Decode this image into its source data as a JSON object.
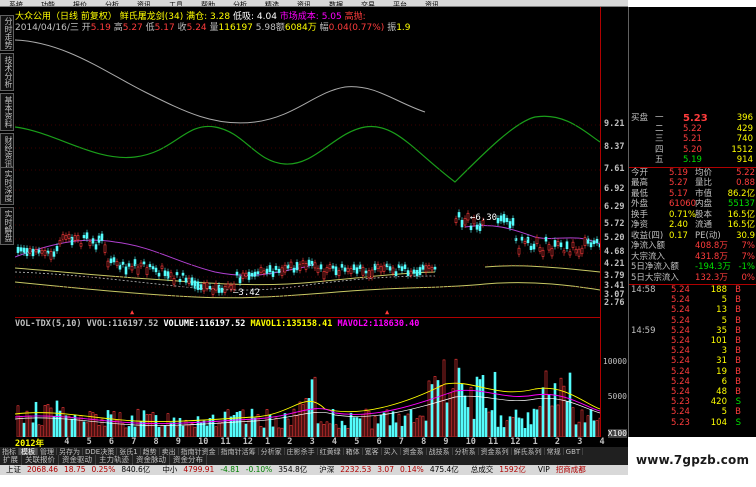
{
  "colors": {
    "background": "#000000",
    "up": "#ff3c3c",
    "down": "#54fcfc",
    "yellow": "#ffff00",
    "magenta": "#ff00ff",
    "white": "#ffffff",
    "axis": "#b00000",
    "green_line": "#1a9e1a",
    "gray_line": "#aaaaaa",
    "purple_line": "#b040d0"
  },
  "menu_strip": [
    "系统",
    "功能",
    "报价",
    "分析",
    "资讯",
    "工具",
    "帮助",
    "分析",
    "精选",
    "资讯",
    "数据",
    "交易",
    "平台",
    "资讯"
  ],
  "left_tabs": [
    "分时走势",
    "技术分析",
    "基本资料",
    "财经资讯",
    "实时深度",
    "实时解盘"
  ],
  "title": {
    "stock": "大众公用（日线 前复权）",
    "formula": "鲜氏屠龙剑(34)",
    "pos_label": "满仓:",
    "pos_value": "3.28",
    "low_label": "低吸:",
    "low_value": "4.04",
    "cost_label": "市场成本:",
    "cost_value": "5.05",
    "hi_label": "高抛:"
  },
  "info": {
    "date": "2014/04/16/三",
    "open_label": "开",
    "open": "5.19",
    "high_label": "高",
    "high": "5.27",
    "low_label": "低",
    "low": "5.17",
    "close_label": "收",
    "close": "5.24",
    "vol_label": "量",
    "vol": "116197",
    "amt": "5.98",
    "amt_label": "6084万",
    "amt_word": "额",
    "chg_label": "幅",
    "chg": "0.04",
    "chg_pct": "(0.77%)",
    "turn_label": "振",
    "turn": "1.9"
  },
  "price_ticks": [
    "9.21",
    "8.37",
    "7.61",
    "6.92",
    "6.29",
    "5.72",
    "5.20",
    "4.68",
    "4.21",
    "3.79",
    "3.41",
    "3.07",
    "2.76"
  ],
  "chart_annotations": {
    "high_mark": "6.30",
    "low_mark": "3.42"
  },
  "volume": {
    "title": "VOL-TDX(5,10)",
    "vvol_label": "VVOL:",
    "vvol": "116197.52",
    "volume_label": "VOLUME:",
    "volume": "116197.52",
    "mavol1_label": "MAVOL1:",
    "mavol1": "135158.41",
    "mavol2_label": "MAVOL2:",
    "mavol2": "118630.40",
    "ticks": [
      "10000",
      "5000"
    ],
    "unit": "X100"
  },
  "date_axis": [
    "2012年",
    "4",
    "5",
    "6",
    "7",
    "8",
    "9",
    "10",
    "11",
    "12",
    "1",
    "2",
    "3",
    "4",
    "5",
    "6",
    "7",
    "8",
    "9",
    "10",
    "11",
    "12",
    "1",
    "2",
    "3",
    "4"
  ],
  "bottom_tabs": [
    "指标",
    "模板",
    "管理",
    "另存为",
    "DDE决策",
    "张氏1",
    "趋势",
    "卖出",
    "指南针资金",
    "指南针活筹",
    "分析家",
    "庄影杀手",
    "红黄绿",
    "箱体",
    "宽客",
    "买入",
    "资金系",
    "战技系",
    "分析系",
    "资金系列",
    "鲜氏系列",
    "常规",
    "GBT"
  ],
  "sub_tabs": [
    "扩展",
    "关联报价",
    "资金驱动",
    "主力轨迹",
    "资金脉动",
    "资金分布"
  ],
  "status_bar": [
    {
      "label": "上证",
      "value": "2068.46",
      "chg": "18.75",
      "pct": "0.25%",
      "amt": "840.6亿"
    },
    {
      "label": "中小",
      "value": "4799.91",
      "chg": "-4.81",
      "pct": "-0.10%",
      "amt": "354.8亿"
    },
    {
      "label": "沪深",
      "value": "2232.53",
      "chg": "3.07",
      "pct": "0.14%",
      "amt": "475.4亿"
    },
    {
      "label": "总成交",
      "value": "1592亿"
    },
    {
      "label": "VIP",
      "value": "招商成都"
    }
  ],
  "right_panel": {
    "bids": [
      {
        "label": "一",
        "price": "5.23",
        "vol": "396"
      },
      {
        "label": "二",
        "price": "5.22",
        "vol": "429"
      },
      {
        "label": "三",
        "price": "5.21",
        "vol": "740"
      },
      {
        "label": "四",
        "price": "5.20",
        "vol": "1512"
      },
      {
        "label": "五",
        "price": "5.19",
        "vol": "914"
      }
    ],
    "bids_title": "买盘",
    "stats": [
      {
        "l1": "今开",
        "v1": "5.19",
        "l2": "均价",
        "v2": "5.22"
      },
      {
        "l1": "最高",
        "v1": "5.27",
        "l2": "量比",
        "v2": "0.88"
      },
      {
        "l1": "最低",
        "v1": "5.17",
        "l2": "市值",
        "v2": "86.2亿"
      },
      {
        "l1": "外盘",
        "v1": "61060",
        "l2": "内盘",
        "v2": "55137"
      },
      {
        "l1": "换手",
        "v1": "0.71%",
        "l2": "股本",
        "v2": "16.5亿"
      },
      {
        "l1": "净资",
        "v1": "2.40",
        "l2": "流通",
        "v2": "16.5亿"
      },
      {
        "l1": "收益(四)",
        "v1": "0.17",
        "l2": "PE(动)",
        "v2": "30.9"
      }
    ],
    "flows": [
      {
        "label": "净流入额",
        "value": "408.8万",
        "pct": "7%"
      },
      {
        "label": "大宗流入",
        "value": "431.8万",
        "pct": "7%"
      },
      {
        "label": "5日净流入额",
        "value": "-194.3万",
        "pct": "-1%"
      },
      {
        "label": "5日大宗流入",
        "value": "132.3万",
        "pct": "0%"
      }
    ],
    "ticks": [
      {
        "time": "14:58",
        "price": "5.24",
        "vol": "188",
        "side": "B"
      },
      {
        "time": "",
        "price": "5.24",
        "vol": "5",
        "side": "B"
      },
      {
        "time": "",
        "price": "5.24",
        "vol": "13",
        "side": "B"
      },
      {
        "time": "",
        "price": "5.24",
        "vol": "5",
        "side": "B"
      },
      {
        "time": "14:59",
        "price": "5.24",
        "vol": "35",
        "side": "B"
      },
      {
        "time": "",
        "price": "5.24",
        "vol": "101",
        "side": "B"
      },
      {
        "time": "",
        "price": "5.24",
        "vol": "3",
        "side": "B"
      },
      {
        "time": "",
        "price": "5.24",
        "vol": "31",
        "side": "B"
      },
      {
        "time": "",
        "price": "5.24",
        "vol": "19",
        "side": "B"
      },
      {
        "time": "",
        "price": "5.24",
        "vol": "6",
        "side": "B"
      },
      {
        "time": "",
        "price": "5.24",
        "vol": "48",
        "side": "B"
      },
      {
        "time": "",
        "price": "5.23",
        "vol": "420",
        "side": "S"
      },
      {
        "time": "",
        "price": "5.24",
        "vol": "5",
        "side": "B"
      },
      {
        "time": "",
        "price": "5.23",
        "vol": "104",
        "side": "S"
      }
    ]
  },
  "watermark": "www.7gpzb.com"
}
